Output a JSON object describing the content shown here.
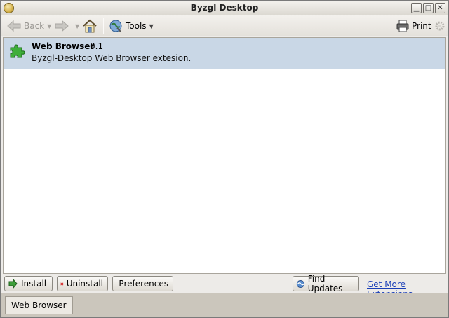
{
  "window": {
    "title": "Byzgl Desktop"
  },
  "toolbar": {
    "back_label": "Back",
    "tools_label": "Tools",
    "print_label": "Print"
  },
  "extensions": [
    {
      "name": "Web Browser",
      "version": "0.1",
      "description": "Byzgl-Desktop Web Browser extesion."
    }
  ],
  "buttons": {
    "install": "Install",
    "uninstall": "Uninstall",
    "preferences": "Preferences",
    "find_updates": "Find Updates"
  },
  "links": {
    "get_more": "Get More Extensions"
  },
  "taskbar": {
    "tab_label": "Web Browser"
  },
  "colors": {
    "selected_row": "#c9d7e6",
    "link": "#1a3fb8"
  }
}
